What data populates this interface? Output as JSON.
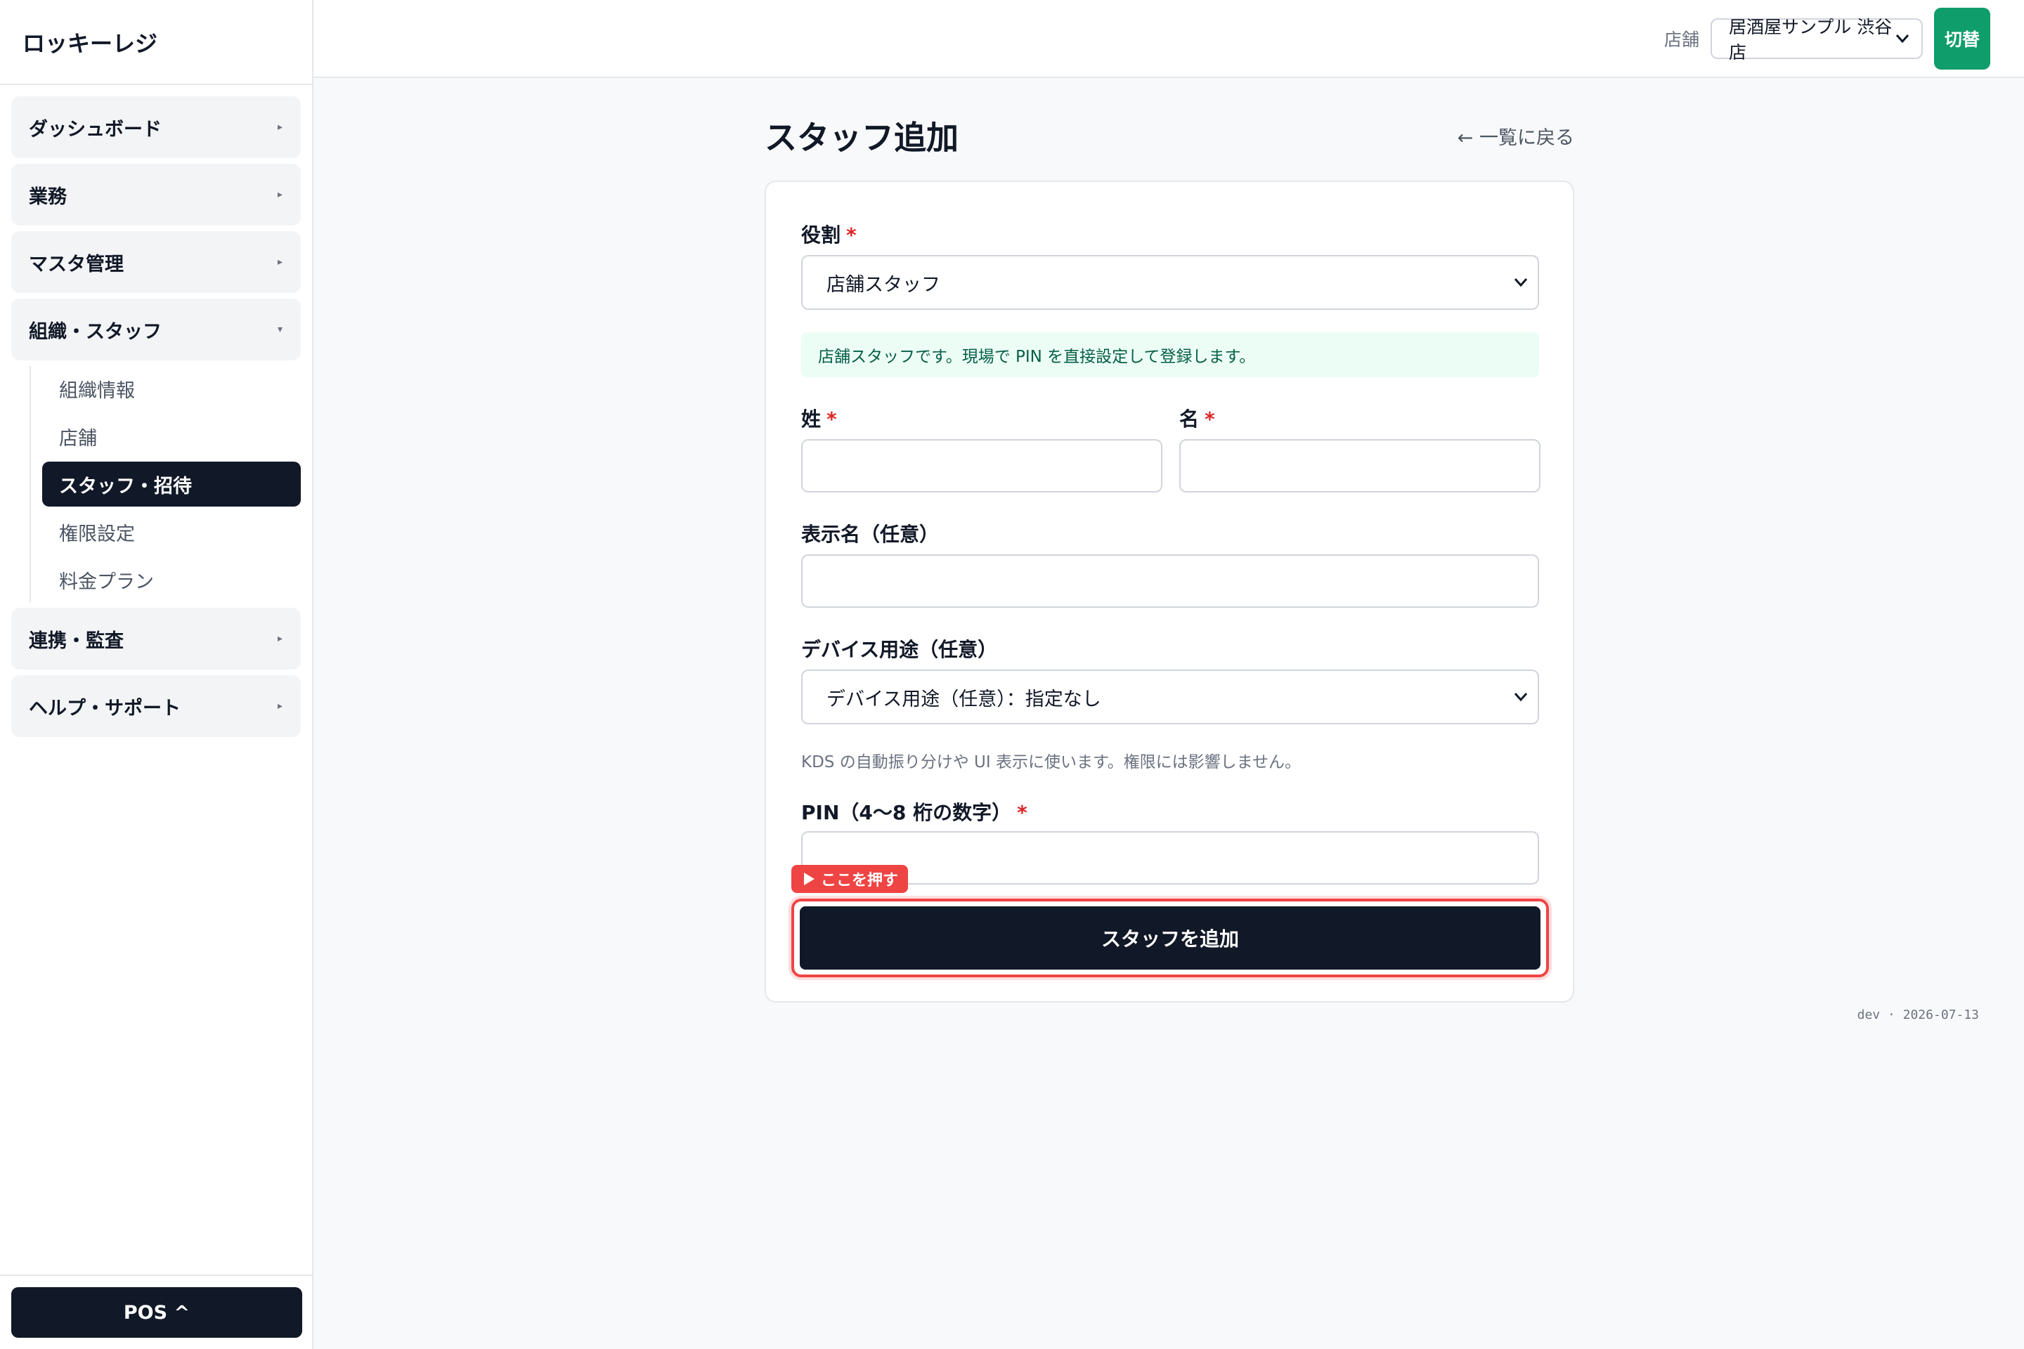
{
  "app": {
    "title": "ロッキーレジ"
  },
  "sidebar": {
    "groups": [
      {
        "label": "ダッシュボード",
        "caret": "▸"
      },
      {
        "label": "業務",
        "caret": "▸"
      },
      {
        "label": "マスタ管理",
        "caret": "▸"
      },
      {
        "label": "組織・スタッフ",
        "caret": "▾"
      },
      {
        "label": "連携・監査",
        "caret": "▸"
      },
      {
        "label": "ヘルプ・サポート",
        "caret": "▸"
      }
    ],
    "subitems": [
      {
        "label": "組織情報"
      },
      {
        "label": "店舗"
      },
      {
        "label": "スタッフ・招待"
      },
      {
        "label": "権限設定"
      },
      {
        "label": "料金プラン"
      }
    ],
    "footer_button": "POS ^"
  },
  "header": {
    "store_label": "店舗",
    "store_value": "居酒屋サンプル 渋谷店",
    "switch_button": "切替"
  },
  "page": {
    "title": "スタッフ追加",
    "back_link": "← 一覧に戻る"
  },
  "form": {
    "role_label": "役割",
    "role_value": "店舗スタッフ",
    "role_info": "店舗スタッフです。現場で PIN を直接設定して登録します。",
    "last_name_label": "姓",
    "first_name_label": "名",
    "display_name_label": "表示名（任意）",
    "device_label": "デバイス用途（任意）",
    "device_value": "デバイス用途（任意）：指定なし",
    "device_hint": "KDS の自動振り分けや UI 表示に使います。権限には影響しません。",
    "pin_label": "PIN（4〜8 桁の数字）",
    "required_mark": "*",
    "marker_label": "ここを押す",
    "submit_label": "スタッフを追加"
  },
  "footer": {
    "meta": "dev · 2026-07-13"
  }
}
